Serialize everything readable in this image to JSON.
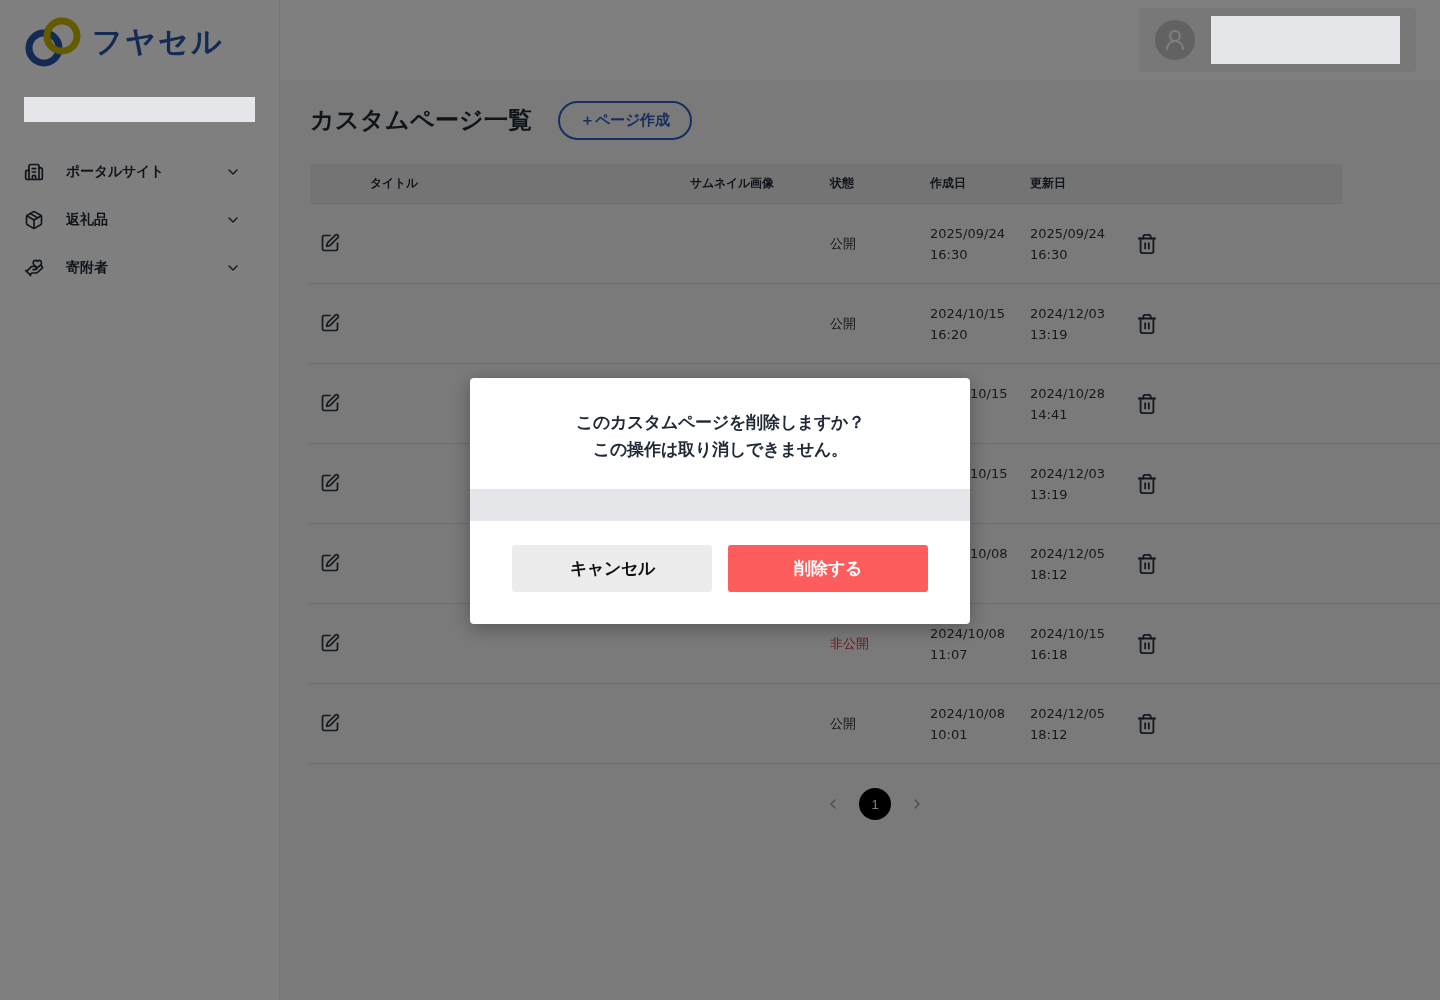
{
  "logo": {
    "text": "フヤセル"
  },
  "sidebar": {
    "items": [
      {
        "label": "ポータルサイト",
        "expanded": false
      },
      {
        "label": "返礼品",
        "expanded": false
      },
      {
        "label": "寄附者",
        "expanded": false
      }
    ]
  },
  "page": {
    "title": "カスタムページ一覧",
    "create_button": "＋ページ作成"
  },
  "table": {
    "columns": [
      "タイトル",
      "サムネイル画像",
      "状態",
      "作成日",
      "更新日"
    ],
    "rows": [
      {
        "status": "公開",
        "published": true,
        "created": [
          "2025/09/24",
          "16:30"
        ],
        "updated": [
          "2025/09/24",
          "16:30"
        ]
      },
      {
        "status": "公開",
        "published": true,
        "created": [
          "2024/10/15",
          "16:20"
        ],
        "updated": [
          "2024/12/03",
          "13:19"
        ]
      },
      {
        "created_clipped": "10/15",
        "updated": [
          "2024/10/28",
          "14:41"
        ]
      },
      {
        "created_clipped": "10/15",
        "updated": [
          "2024/12/03",
          "13:19"
        ]
      },
      {
        "created_clipped": "10/08",
        "updated": [
          "2024/12/05",
          "18:12"
        ]
      },
      {
        "status": "非公開",
        "published": false,
        "created": [
          "2024/10/08",
          "11:07"
        ],
        "updated": [
          "2024/10/15",
          "16:18"
        ]
      },
      {
        "status": "公開",
        "published": true,
        "created": [
          "2024/10/08",
          "10:01"
        ],
        "updated": [
          "2024/12/05",
          "18:12"
        ]
      }
    ]
  },
  "pagination": {
    "pages": [
      {
        "label": "1",
        "selected": true
      }
    ]
  },
  "dialog": {
    "message": [
      "このカスタムページを削除しますか？",
      "この操作は取り消しできません。"
    ],
    "cancel_button": "キャンセル",
    "confirm_button": "削除する"
  }
}
